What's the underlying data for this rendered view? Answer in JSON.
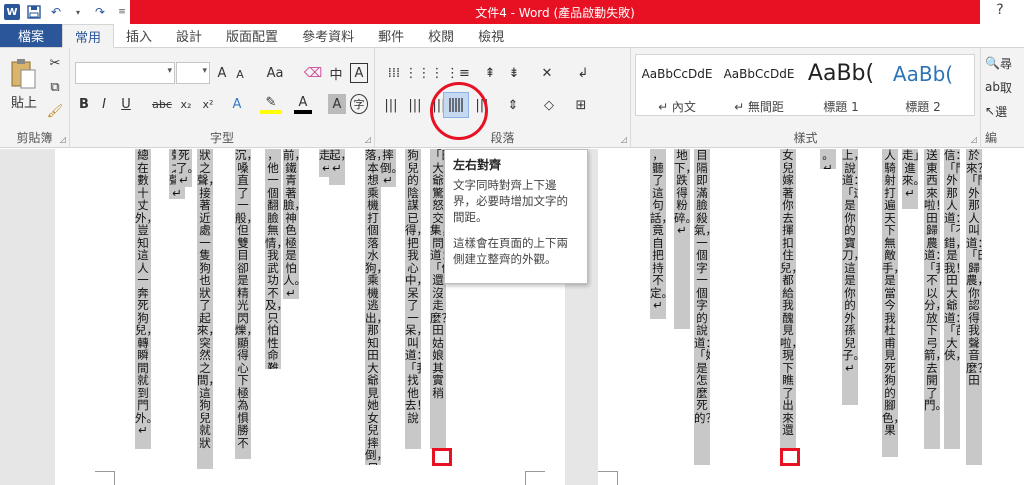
{
  "window": {
    "title": "文件4 - Word (產品啟動失敗)",
    "help": "?"
  },
  "tabs": [
    {
      "label": "檔案"
    },
    {
      "label": "常用"
    },
    {
      "label": "插入"
    },
    {
      "label": "設計"
    },
    {
      "label": "版面配置"
    },
    {
      "label": "參考資料"
    },
    {
      "label": "郵件"
    },
    {
      "label": "校閱"
    },
    {
      "label": "檢視"
    }
  ],
  "ribbon": {
    "clipboard": {
      "label": "剪貼簿",
      "paste": "貼上"
    },
    "font": {
      "label": "字型",
      "bold": "B",
      "italic": "I",
      "underline": "U",
      "strike": "abc",
      "sub": "x₂",
      "sup": "x²",
      "grow": "A",
      "shrink": "A",
      "case": "Aa",
      "phonetic": "中",
      "border_char": "A",
      "text_effect": "A",
      "font_color": "A",
      "shade": "A",
      "enclose": "字"
    },
    "paragraph": {
      "label": "段落"
    },
    "styles": {
      "label": "樣式",
      "items": [
        {
          "sample": "AaBbCcDdE",
          "name": "↵ 內文"
        },
        {
          "sample": "AaBbCcDdE",
          "name": "↵ 無間距"
        },
        {
          "sample": "AaBb(",
          "name": "標題 1"
        },
        {
          "sample": "AaBb(",
          "name": "標題 2"
        }
      ]
    },
    "editing": {
      "label": "編",
      "find": "尋",
      "replace": "取",
      "select": "選"
    }
  },
  "tooltip": {
    "title": "左右對齊",
    "body": "文字同時對齊上下邊界，必要時增加文字的間距。",
    "body2": "這樣會在頁面的上下兩側建立整齊的外觀。"
  },
  "document": {
    "page1_columns": [
      "總在數十丈外，豈知這人一奔死狗兒，轉瞬間就到門外。↵",
      "聲之聲。↵",
      "死了。↵",
      "狀之聲，接著近處一隻狗也狀了起來，突然之間，這狗兒就狀",
      "沉，嗓直了一般，但雙目卻是精光閃爍，顯得心下極為惧勝不",
      "，他一個翻臉無情，我武功不及，只怕性命難保。」↵",
      "前，鐵青著臉，神色極是怕人。↵",
      "走，↵",
      "起，↵",
      "落，本想乘機打個落水狗，乘機逃出，那知田大爺見她女兒摔倒，只歎",
      "摔倒。↵",
      "狗兒的陰謀已得，把我心中，呆了一呆，叫道：「我找他去！」說",
      "「田大爺驚怒交集，問道：「他還沒走麼？」田姑娘其實稍"
    ],
    "page2_columns": [
      "，聽了這句話，竟自把持不定。↵",
      "地下，跌得粉碎。↵",
      "目隔即滿臉殺氣，一個字一個字的說道：「她是怎麼死的？」",
      "女兒嫁著你去揮扣住兒，都給我醜見啦，現下瞧了出來還",
      "。↵",
      "上，說道：「這是你的寶刀，這是你的外孫兒子。」↵",
      "走」進來。↵",
      "人騎射打遍天下無敵手，是當今我杜甫見死狗的腳色，果",
      "送東西來啦！」田歸農道：「我不以分，放下弓箭，去開了門。",
      "信：「門外那人道：「不錯，是我！」田大爺道：「苗大俠，",
      "於來？」「門外那人叫道：「田歸農，你認得我聲音麼？」田"
    ]
  }
}
